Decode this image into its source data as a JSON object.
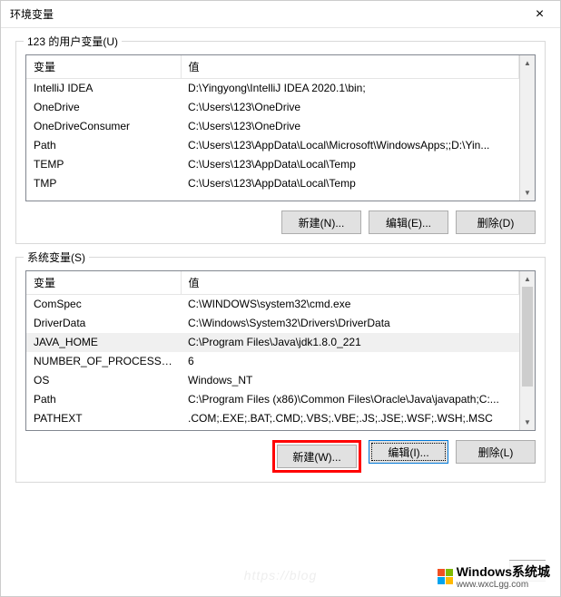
{
  "window": {
    "title": "环境变量",
    "close_glyph": "×"
  },
  "user_section": {
    "label": "123 的用户变量(U)",
    "headers": {
      "var": "变量",
      "value": "值"
    },
    "rows": [
      {
        "var": "IntelliJ IDEA",
        "value": "D:\\Yingyong\\IntelliJ IDEA 2020.1\\bin;"
      },
      {
        "var": "OneDrive",
        "value": "C:\\Users\\123\\OneDrive"
      },
      {
        "var": "OneDriveConsumer",
        "value": "C:\\Users\\123\\OneDrive"
      },
      {
        "var": "Path",
        "value": "C:\\Users\\123\\AppData\\Local\\Microsoft\\WindowsApps;;D:\\Yin..."
      },
      {
        "var": "TEMP",
        "value": "C:\\Users\\123\\AppData\\Local\\Temp"
      },
      {
        "var": "TMP",
        "value": "C:\\Users\\123\\AppData\\Local\\Temp"
      }
    ],
    "buttons": {
      "new": "新建(N)...",
      "edit": "编辑(E)...",
      "delete": "删除(D)"
    }
  },
  "system_section": {
    "label": "系统变量(S)",
    "headers": {
      "var": "变量",
      "value": "值"
    },
    "rows": [
      {
        "var": "ComSpec",
        "value": "C:\\WINDOWS\\system32\\cmd.exe"
      },
      {
        "var": "DriverData",
        "value": "C:\\Windows\\System32\\Drivers\\DriverData"
      },
      {
        "var": "JAVA_HOME",
        "value": "C:\\Program Files\\Java\\jdk1.8.0_221",
        "selected": true
      },
      {
        "var": "NUMBER_OF_PROCESSORS",
        "value": "6"
      },
      {
        "var": "OS",
        "value": "Windows_NT"
      },
      {
        "var": "Path",
        "value": "C:\\Program Files (x86)\\Common Files\\Oracle\\Java\\javapath;C:..."
      },
      {
        "var": "PATHEXT",
        "value": ".COM;.EXE;.BAT;.CMD;.VBS;.VBE;.JS;.JSE;.WSF;.WSH;.MSC"
      }
    ],
    "buttons": {
      "new": "新建(W)...",
      "edit": "编辑(I)...",
      "delete": "删除(L)"
    }
  },
  "watermark": {
    "brand": "Windows系统城",
    "url": "www.wxcLgg.com"
  }
}
